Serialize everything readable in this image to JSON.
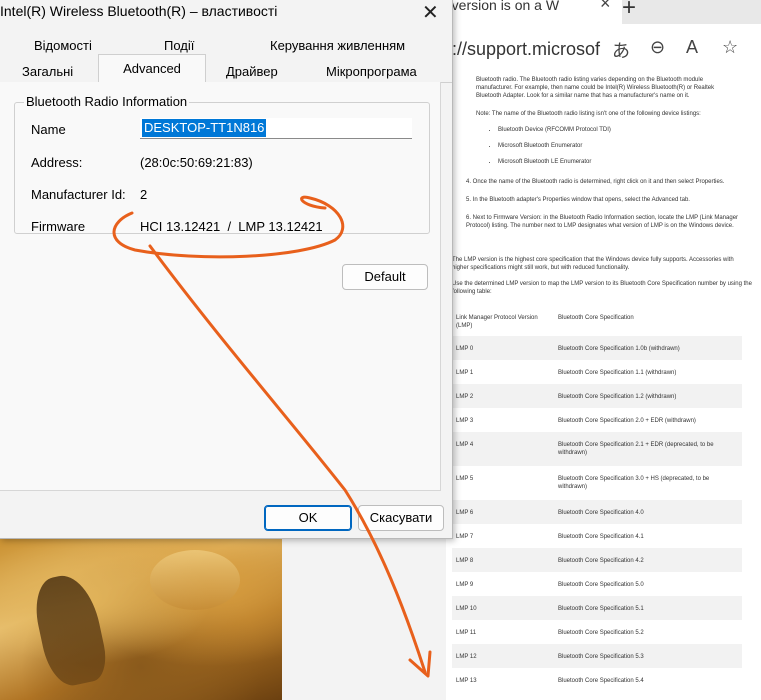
{
  "dialog": {
    "title": "Intel(R) Wireless Bluetooth(R) – властивості",
    "tabs_top": [
      "Відомості",
      "Події",
      "Керування живленням"
    ],
    "tabs_bottom": [
      "Загальні",
      "Advanced",
      "Драйвер",
      "Мікропрограма"
    ],
    "active_tab": "Advanced",
    "group_title": "Bluetooth Radio Information",
    "fields": [
      {
        "label": "Name",
        "value": "DESKTOP-TT1N816"
      },
      {
        "label": "Address:",
        "value": "(28:0c:50:69:21:83)"
      },
      {
        "label": "Manufacturer Id:",
        "value": "2"
      },
      {
        "label": "Firmware",
        "value": "HCI 13.12421  /  LMP 13.12421"
      }
    ],
    "default_button": "Default",
    "ok_button": "OK",
    "cancel_button": "Скасувати"
  },
  "browser": {
    "tab_title": "h version is on a W",
    "url": "://support.microsof",
    "page": {
      "intro": "Bluetooth radio. The Bluetooth radio listing varies depending on the Bluetooth module manufacturer. For example, then name could be Intel(R) Wireless Bluetooth(R) or Realtek Bluetooth Adapter. Look for a similar name that has a manufacturer's name on it.",
      "note": "Note: The name of the Bluetooth radio listing isn't one of the following device listings:",
      "note_items": [
        "Bluetooth Device (RFCOMM Protocol TDI)",
        "Microsoft Bluetooth Enumerator",
        "Microsoft Bluetooth LE Enumerator"
      ],
      "step4": "4.  Once the name of the Bluetooth radio is determined, right click on it and then select Properties.",
      "step5": "5.  In the Bluetooth adapter's Properties window that opens, select the Advanced tab.",
      "step6": "6.  Next to Firmware Version: in the Bluetooth Radio Information section, locate the LMP (Link Manager Protocol) listing. The number next to LMP designates what version of LMP is on the Windows device.",
      "para1": "The LMP version is the highest core specification that the Windows device fully supports. Accessories with higher specifications might still work, but with reduced functionality.",
      "para2": "Use the determined LMP version to map the LMP version to its Bluetooth Core Specification number by using the following table:",
      "table_headers": [
        "Link Manager Protocol Version (LMP)",
        "Bluetooth Core Specification"
      ],
      "table_rows": [
        [
          "LMP 0",
          "Bluetooth Core Specification 1.0b (withdrawn)"
        ],
        [
          "LMP 1",
          "Bluetooth Core Specification 1.1 (withdrawn)"
        ],
        [
          "LMP 2",
          "Bluetooth Core Specification 1.2 (withdrawn)"
        ],
        [
          "LMP 3",
          "Bluetooth Core Specification 2.0 + EDR (withdrawn)"
        ],
        [
          "LMP 4",
          "Bluetooth Core Specification 2.1 + EDR (deprecated, to be withdrawn)"
        ],
        [
          "LMP 5",
          "Bluetooth Core Specification 3.0 + HS (deprecated, to be withdrawn)"
        ],
        [
          "LMP 6",
          "Bluetooth Core Specification 4.0"
        ],
        [
          "LMP 7",
          "Bluetooth Core Specification 4.1"
        ],
        [
          "LMP 8",
          "Bluetooth Core Specification 4.2"
        ],
        [
          "LMP 9",
          "Bluetooth Core Specification 5.0"
        ],
        [
          "LMP 10",
          "Bluetooth Core Specification 5.1"
        ],
        [
          "LMP 11",
          "Bluetooth Core Specification 5.2"
        ],
        [
          "LMP 12",
          "Bluetooth Core Specification 5.3"
        ],
        [
          "LMP 13",
          "Bluetooth Core Specification 5.4"
        ]
      ]
    }
  },
  "colors": {
    "annotation": "#e8601c",
    "selection": "#0078d7",
    "accent": "#0067c0"
  }
}
